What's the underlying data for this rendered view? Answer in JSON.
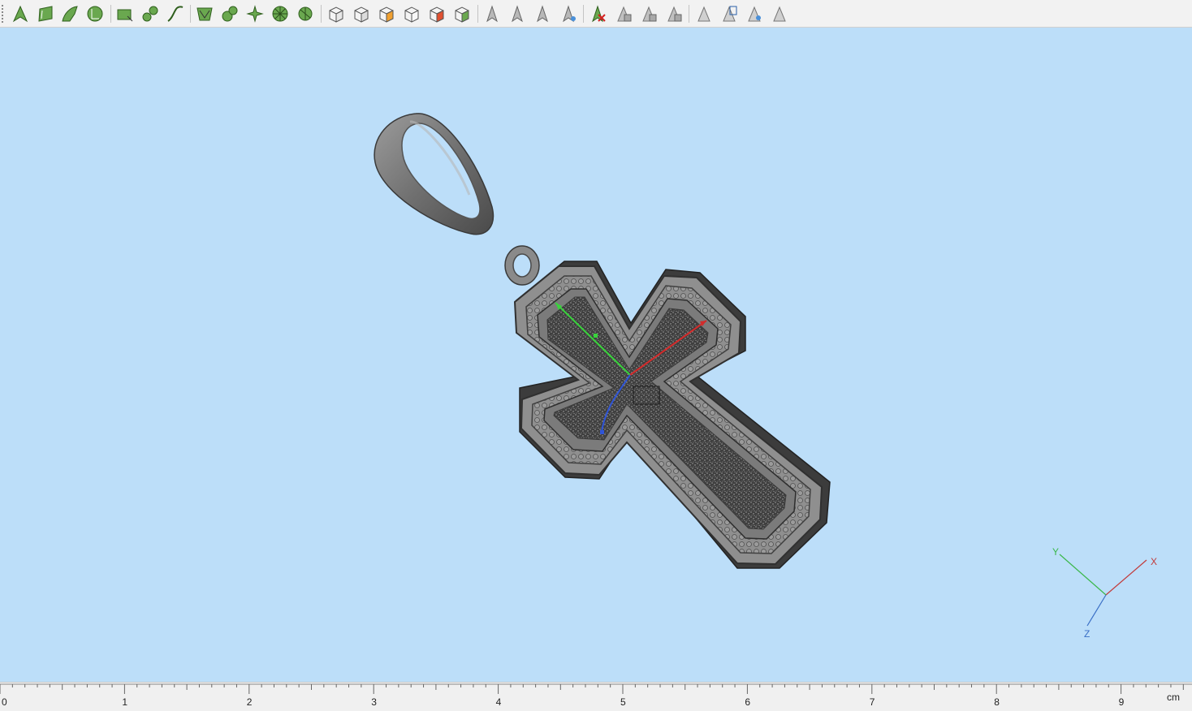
{
  "toolbar": {
    "tools": [
      {
        "id": "select-arrow-icon"
      },
      {
        "id": "select-face-icon"
      },
      {
        "id": "select-edge-icon"
      },
      {
        "id": "select-loop-icon"
      },
      {
        "id": "rectangle-select-icon"
      },
      {
        "id": "lasso-select-icon"
      },
      {
        "id": "curve-select-icon"
      },
      {
        "id": "mesh-select-icon"
      },
      {
        "id": "paint-select-icon"
      },
      {
        "id": "pattern-select-icon"
      },
      {
        "id": "radial-select-icon"
      },
      {
        "id": "partial-radial-select-icon"
      },
      {
        "id": "view-cube-icon"
      },
      {
        "id": "view-cube-side-icon"
      },
      {
        "id": "view-cube-top-icon"
      },
      {
        "id": "view-cube-wire-icon"
      },
      {
        "id": "view-cube-red-icon"
      },
      {
        "id": "view-cube-green-icon"
      },
      {
        "id": "pointer-tool-icon"
      },
      {
        "id": "pointer-edit-icon"
      },
      {
        "id": "pointer-move-icon"
      },
      {
        "id": "pointer-snap-icon"
      },
      {
        "id": "delete-red-x-icon"
      },
      {
        "id": "shade-tool-icon"
      },
      {
        "id": "copy-tool-icon"
      },
      {
        "id": "transform-tool-icon"
      },
      {
        "id": "hide-tool-icon"
      },
      {
        "id": "layer-tool-icon"
      },
      {
        "id": "view-tool-icon"
      },
      {
        "id": "measure-tool-icon"
      }
    ]
  },
  "viewport": {
    "background": "#bcdef9",
    "axis_indicator": {
      "x_label": "X",
      "y_label": "Y",
      "z_label": "Z",
      "x_color": "#c23b3b",
      "y_color": "#3cb84c",
      "z_color": "#3a6fc6"
    }
  },
  "ruler": {
    "labels": [
      "0",
      "1",
      "2",
      "3",
      "4",
      "5",
      "6",
      "7",
      "8",
      "9"
    ],
    "unit": "cm"
  }
}
